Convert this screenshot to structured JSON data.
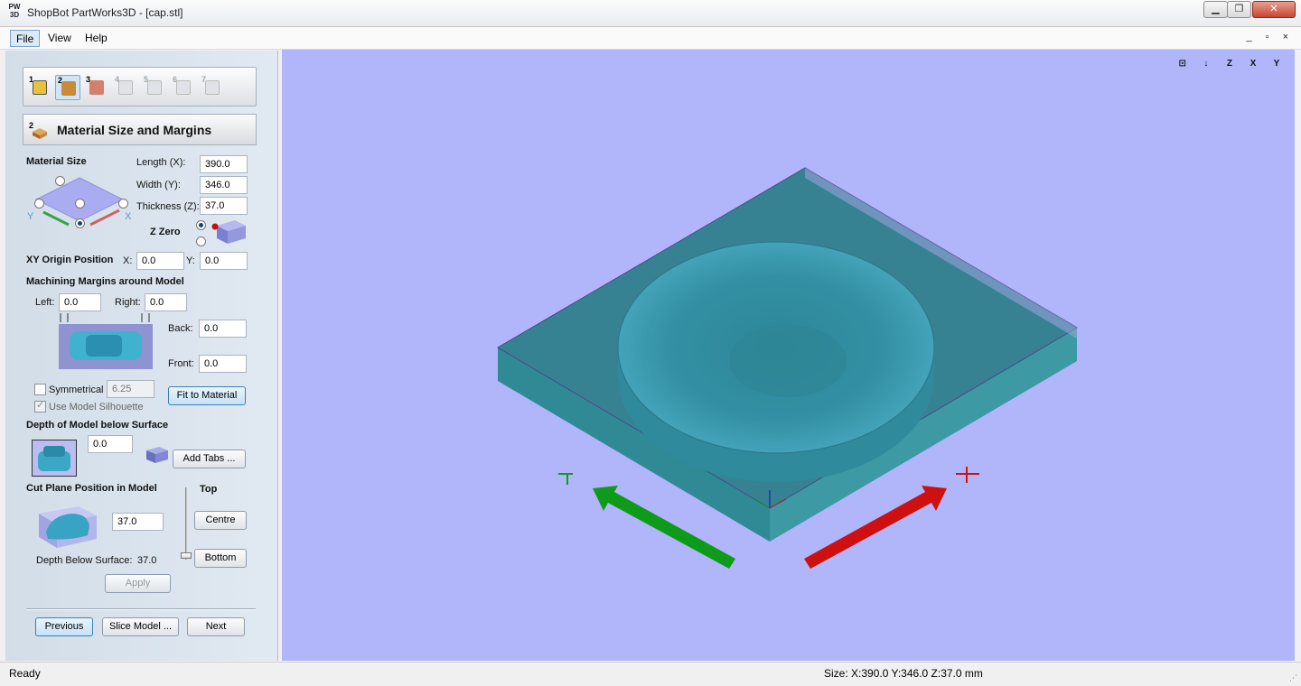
{
  "window": {
    "title": "ShopBot PartWorks3D - [cap.stl]",
    "app_icon_text": "PW 3D",
    "controls": [
      "▁",
      "❐",
      "✕"
    ]
  },
  "menu": [
    "File",
    "View",
    "Help"
  ],
  "mdi_controls": "_ ▫ ×",
  "steps": [
    {
      "num": "1",
      "icon": "cube-icon"
    },
    {
      "num": "2",
      "icon": "material-block-icon"
    },
    {
      "num": "3",
      "icon": "orient-model-icon"
    },
    {
      "num": "4",
      "icon": "toolpath-icon"
    },
    {
      "num": "5",
      "icon": "finishing-icon"
    },
    {
      "num": "6",
      "icon": "preview-icon"
    },
    {
      "num": "7",
      "icon": "save-toolpath-icon"
    }
  ],
  "section": {
    "number": "2",
    "title": "Material Size and Margins"
  },
  "material_size": {
    "label": "Material Size",
    "length_label": "Length (X):",
    "length": "390.0",
    "width_label": "Width (Y):",
    "width": "346.0",
    "thickness_label": "Thickness (Z):",
    "thickness": "37.0",
    "axis_y": "Y",
    "axis_x": "X",
    "z_zero_label": "Z Zero"
  },
  "xy_origin": {
    "label": "XY Origin Position",
    "x_label": "X:",
    "x": "0.0",
    "y_label": "Y:",
    "y": "0.0"
  },
  "margins": {
    "label": "Machining Margins around Model",
    "left_label": "Left:",
    "left": "0.0",
    "right_label": "Right:",
    "right": "0.0",
    "back_label": "Back:",
    "back": "0.0",
    "front_label": "Front:",
    "front": "0.0",
    "symmetrical_label": "Symmetrical",
    "symmetrical_value": "6.25",
    "silhouette_label": "Use Model Silhouette",
    "fit_button": "Fit to Material"
  },
  "depth": {
    "label": "Depth of Model below Surface",
    "value": "0.0",
    "add_tabs_button": "Add Tabs ..."
  },
  "cut_plane": {
    "label": "Cut Plane Position in Model",
    "top_label": "Top",
    "value": "37.0",
    "centre_button": "Centre",
    "bottom_button": "Bottom",
    "depth_label": "Depth Below Surface:",
    "depth_value": "37.0"
  },
  "apply_button": "Apply",
  "nav": {
    "previous": "Previous",
    "slice": "Slice Model ...",
    "next": "Next"
  },
  "view_icons": [
    "fit-view-icon",
    "iso-view-icon",
    "top-z-view-icon",
    "front-x-view-icon",
    "side-y-view-icon"
  ],
  "view_icon_labels": [
    "⊡",
    "↓",
    "Z",
    "X",
    "Y"
  ],
  "status": {
    "left": "Ready",
    "right": "Size: X:390.0 Y:346.0 Z:37.0 mm"
  },
  "colors": {
    "viewport_bg": "#b1b6fb",
    "material": "#2f8a95",
    "model": "#3c93a6",
    "x_axis": "#cf1010",
    "y_axis": "#0e9b1a"
  }
}
